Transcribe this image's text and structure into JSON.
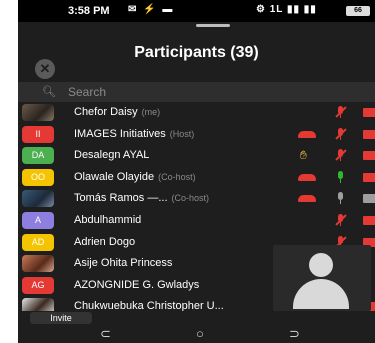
{
  "status_bar": {
    "time": "3:58 PM",
    "notif_icons": "✉ ⚡ ▬",
    "right_icons": "⚙ 1L ▮▮ ▮▮",
    "battery": "66"
  },
  "panel": {
    "title": "Participants (39)",
    "close_icon": "✕"
  },
  "search": {
    "placeholder": "Search",
    "icon": "search-icon"
  },
  "participants": [
    {
      "name": "Chefor Daisy",
      "tag": "(me)",
      "avatar": "photo",
      "initials": ""
    },
    {
      "name": "IMAGES Initiatives",
      "tag": "(Host)",
      "avatar_color": "#e53935",
      "initials": "II"
    },
    {
      "name": "Desalegn AYAL",
      "tag": "",
      "avatar_color": "#4caf50",
      "initials": "DA"
    },
    {
      "name": "Olawale Olayide",
      "tag": "(Co-host)",
      "avatar_color": "#f5c400",
      "initials": "OO"
    },
    {
      "name": "Tomás Ramos —...",
      "tag": "(Co-host)",
      "avatar": "photo",
      "initials": ""
    },
    {
      "name": "Abdulhammid",
      "tag": "",
      "avatar_color": "#8e7ee0",
      "initials": "A"
    },
    {
      "name": "Adrien Dogo",
      "tag": "",
      "avatar_color": "#f5c400",
      "initials": "AD"
    },
    {
      "name": "Asije Ohita Princess",
      "tag": "",
      "avatar": "photo",
      "initials": ""
    },
    {
      "name": "AZONGNIDE G. Gwladys",
      "tag": "",
      "avatar_color": "#e53935",
      "initials": "AG"
    },
    {
      "name": "Chukwuebuka Christopher U...",
      "tag": "",
      "avatar": "photo",
      "initials": ""
    }
  ],
  "colors": {
    "background": "#1e1e1e",
    "muted_red": "#e53935",
    "unmuted_green": "#2eb82e",
    "raised_hand": "#f4c542"
  },
  "bottom": {
    "invite_label": "Invite"
  },
  "nav": {
    "recent": "⊂",
    "home": "○",
    "back": "⊃"
  }
}
